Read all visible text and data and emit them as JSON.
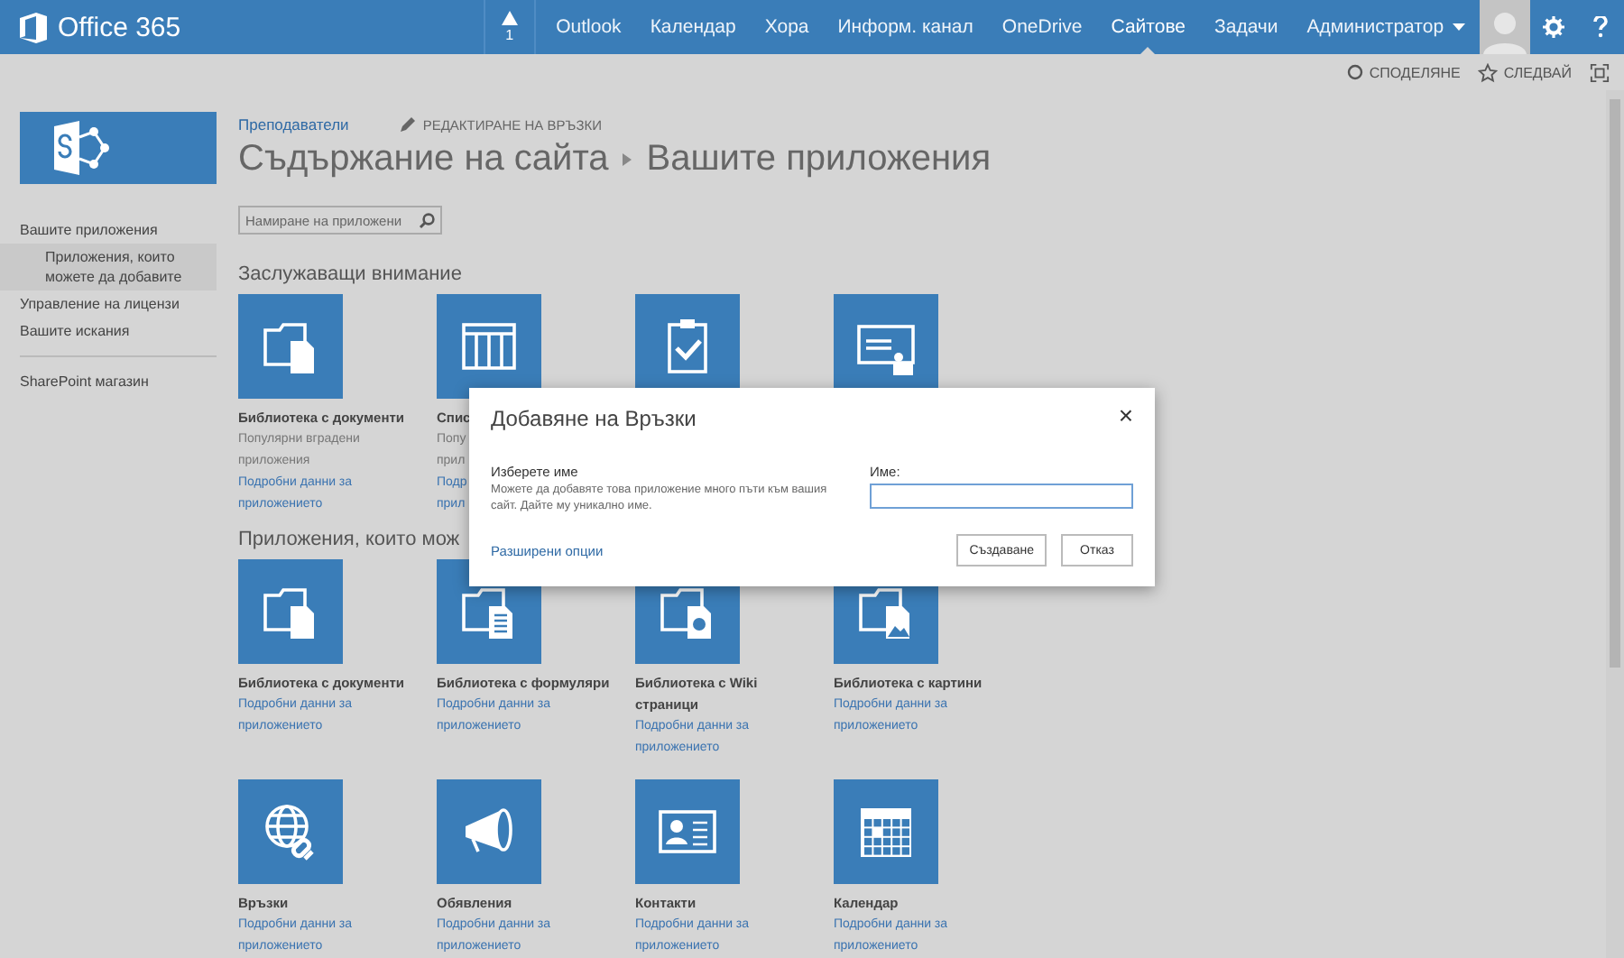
{
  "top_bar": {
    "brand": "Office 365",
    "alert_count": "1",
    "nav": [
      {
        "label": "Outlook",
        "selected": false
      },
      {
        "label": "Календар",
        "selected": false
      },
      {
        "label": "Хора",
        "selected": false
      },
      {
        "label": "Информ. канал",
        "selected": false
      },
      {
        "label": "OneDrive",
        "selected": false
      },
      {
        "label": "Сайтове",
        "selected": true
      },
      {
        "label": "Задачи",
        "selected": false
      },
      {
        "label": "Администратор",
        "selected": false,
        "menu": true
      }
    ]
  },
  "suite_bar": {
    "actions": [
      {
        "kind": "share",
        "label": "СПОДЕЛЯНЕ"
      },
      {
        "kind": "follow",
        "label": "СЛЕДВАЙ"
      },
      {
        "kind": "focus"
      }
    ]
  },
  "sidebar": {
    "items": [
      {
        "label": "Вашите приложения",
        "selected": false,
        "children": [
          {
            "label": "Приложения, които можете да добавите",
            "selected": true
          }
        ]
      },
      {
        "label": "Управление на лицензи",
        "selected": false
      },
      {
        "label": "Вашите искания",
        "selected": false
      },
      {
        "kind": "divider"
      },
      {
        "label": "SharePoint магазин",
        "selected": false
      }
    ]
  },
  "breadcrumb": "Преподаватели",
  "edit_links": "РЕДАКТИРАНЕ НА ВРЪЗКИ",
  "title": {
    "parent": "Съдържание на сайта",
    "current": "Вашите приложения"
  },
  "search": {
    "placeholder": "Намиране на приложени"
  },
  "sections": [
    {
      "heading": "Заслужаващи внимание",
      "tiles": [
        {
          "kind": "documents",
          "name": [
            "Библиотека с документи"
          ],
          "description": [
            "Популярни вградени",
            "приложения"
          ],
          "link": [
            "Подробни данни за",
            "приложението"
          ]
        },
        {
          "kind": "list",
          "name": [
            "Спис"
          ],
          "description": [
            "Попу",
            "прил"
          ],
          "link": [
            "Подр",
            "прил"
          ]
        },
        {
          "kind": "tasks"
        },
        {
          "kind": "card"
        }
      ]
    },
    {
      "heading": "Приложения, които мож",
      "tiles": [
        {
          "kind": "documents",
          "name": [
            "Библиотека с документи"
          ],
          "link": [
            "Подробни данни за",
            "приложението"
          ]
        },
        {
          "kind": "forms",
          "name": [
            "Библиотека с формуляри"
          ],
          "link": [
            "Подробни данни за",
            "приложението"
          ]
        },
        {
          "kind": "wiki",
          "name": [
            "Библиотека с Wiki",
            "страници"
          ],
          "link": [
            "Подробни данни за",
            "приложението"
          ]
        },
        {
          "kind": "pictures",
          "name": [
            "Библиотека с картини"
          ],
          "link": [
            "Подробни данни за",
            "приложението"
          ]
        }
      ]
    },
    {
      "tiles": [
        {
          "kind": "links",
          "name": [
            "Връзки"
          ],
          "link": [
            "Подробни данни за",
            "приложението"
          ]
        },
        {
          "kind": "announcements",
          "name": [
            "Обявления"
          ],
          "link": [
            "Подробни данни за",
            "приложението"
          ]
        },
        {
          "kind": "contacts",
          "name": [
            "Контакти"
          ],
          "link": [
            "Подробни данни за",
            "приложението"
          ]
        },
        {
          "kind": "calendar",
          "name": [
            "Календар"
          ],
          "link": [
            "Подробни данни за",
            "приложението"
          ]
        }
      ]
    }
  ],
  "dialog": {
    "title": "Добавяне на Връзки",
    "close": "×",
    "field_title": "Изберете име",
    "field_help": "Можете да добавяте това приложение много пъти към вашия сайт. Дайте му уникално име.",
    "name_label": "Име:",
    "advanced": "Разширени опции",
    "buttons": [
      "Създаване",
      "Отказ"
    ]
  }
}
